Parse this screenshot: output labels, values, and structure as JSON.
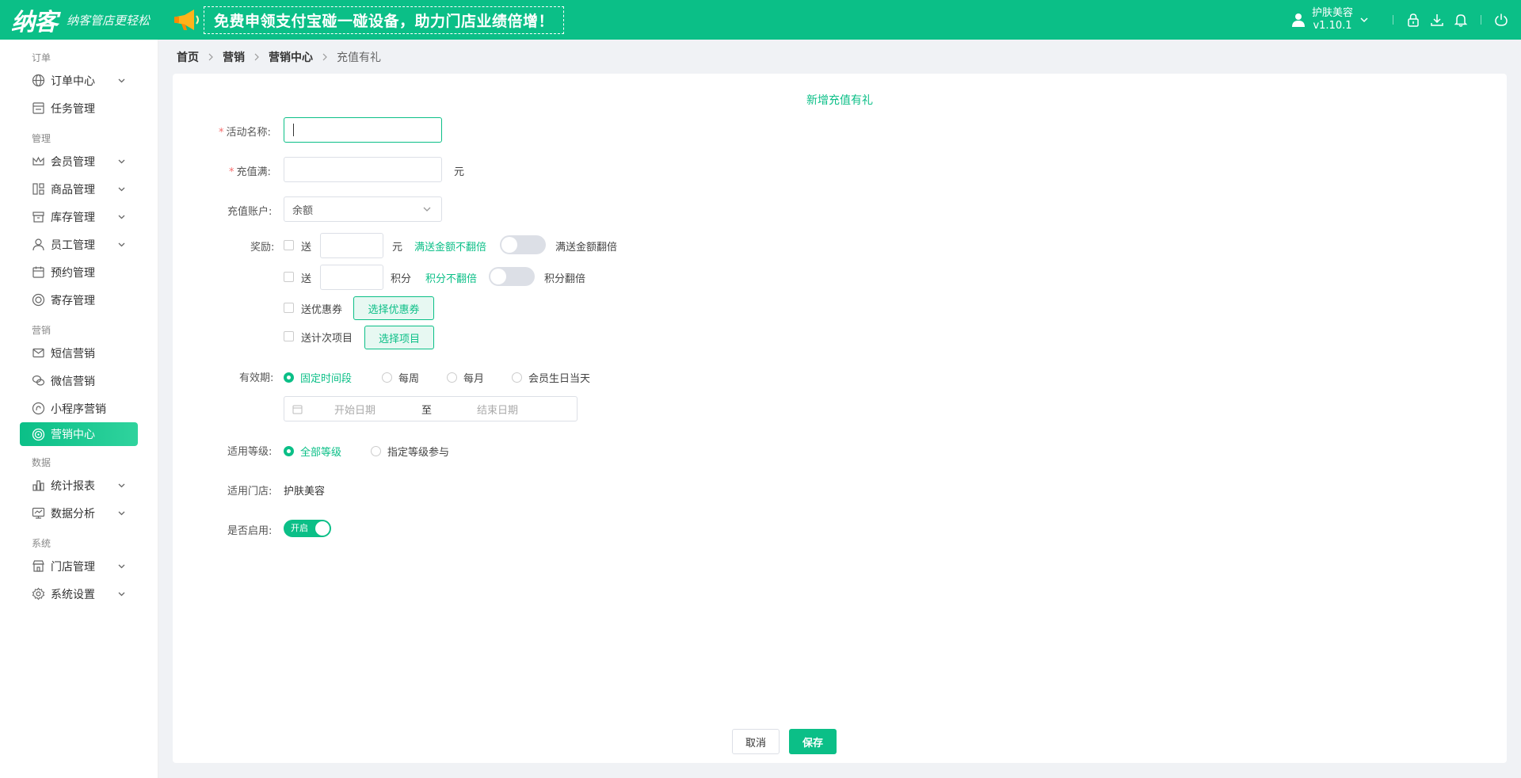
{
  "header": {
    "logo": "纳客",
    "slogan": "纳客管店更轻松",
    "promo": "免费申领支付宝碰一碰设备，助力门店业绩倍增！",
    "user_name": "护肤美容",
    "version": "v1.10.1"
  },
  "sidebar": {
    "groups": {
      "order": "订单",
      "manage": "管理",
      "marketing": "营销",
      "data": "数据",
      "system": "系统"
    },
    "items": {
      "order_center": "订单中心",
      "task_manage": "任务管理",
      "member_manage": "会员管理",
      "goods_manage": "商品管理",
      "stock_manage": "库存管理",
      "staff_manage": "员工管理",
      "booking_manage": "预约管理",
      "deposit_manage": "寄存管理",
      "sms_marketing": "短信营销",
      "wechat_marketing": "微信营销",
      "miniapp_marketing": "小程序营销",
      "marketing_center": "营销中心",
      "stats_report": "统计报表",
      "data_analysis": "数据分析",
      "store_manage": "门店管理",
      "system_settings": "系统设置"
    }
  },
  "breadcrumb": {
    "home": "首页",
    "marketing": "营销",
    "marketing_center": "营销中心",
    "current": "充值有礼"
  },
  "form": {
    "title": "新增充值有礼",
    "activity_name_label": "活动名称:",
    "recharge_label": "充值满:",
    "recharge_unit": "元",
    "account_label": "充值账户:",
    "account_value": "余额",
    "reward_label": "奖励:",
    "send_label": "送",
    "yuan_unit": "元",
    "amount_no_double": "满送金额不翻倍",
    "amount_double": "满送金额翻倍",
    "points_unit": "积分",
    "points_no_double": "积分不翻倍",
    "points_double": "积分翻倍",
    "send_coupon": "送优惠券",
    "choose_coupon": "选择优惠券",
    "send_items": "送计次项目",
    "choose_items": "选择项目",
    "validity_label": "有效期:",
    "validity_options": [
      "固定时间段",
      "每周",
      "每月",
      "会员生日当天"
    ],
    "start_date_placeholder": "开始日期",
    "date_to": "至",
    "end_date_placeholder": "结束日期",
    "level_label": "适用等级:",
    "level_all": "全部等级",
    "level_specific": "指定等级参与",
    "store_label": "适用门店:",
    "store_value": "护肤美容",
    "enable_label": "是否启用:",
    "enable_on": "开启",
    "cancel": "取消",
    "save": "保存"
  },
  "colors": {
    "brand": "#0bbf87",
    "required": "#f56c6c"
  }
}
